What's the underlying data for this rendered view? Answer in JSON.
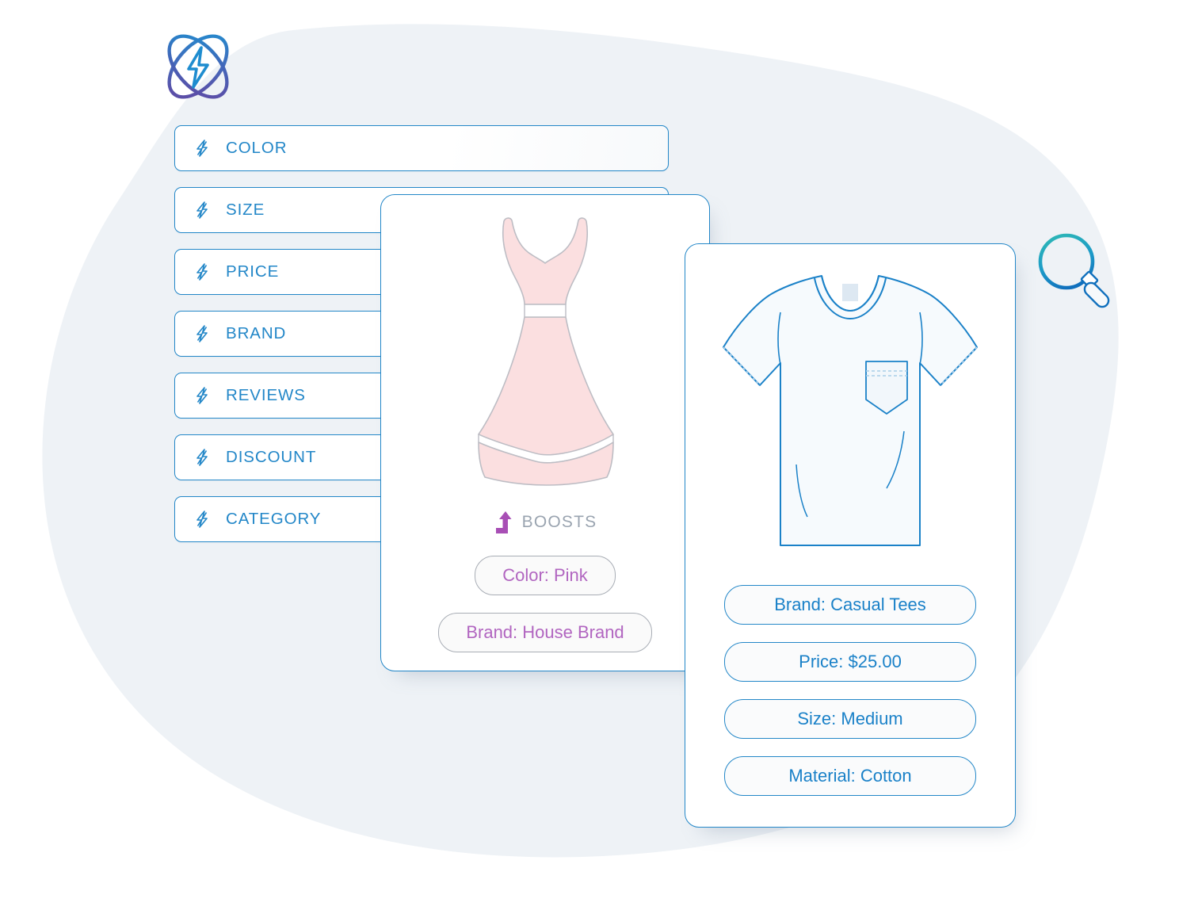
{
  "brand": {
    "logo_icon": "atom-lightning-logo",
    "logo_gradient_from": "#1f8fd0",
    "logo_gradient_to": "#5b4fa8"
  },
  "background": {
    "blob_color": "#eef2f6"
  },
  "facets": {
    "bolt_icon": "lightning-bolt-icon",
    "accent": "#2387c8",
    "items": [
      {
        "label": "COLOR"
      },
      {
        "label": "SIZE"
      },
      {
        "label": "PRICE"
      },
      {
        "label": "BRAND"
      },
      {
        "label": "REVIEWS"
      },
      {
        "label": "DISCOUNT"
      },
      {
        "label": "CATEGORY"
      }
    ]
  },
  "dress_card": {
    "product_icon": "pink-dress-illustration",
    "dress_fill": "#fbdfe0",
    "boosts": {
      "arrow_icon": "boost-up-arrow-icon",
      "arrow_color": "#a84fb5",
      "label": "BOOSTS"
    },
    "pill_text_color": "#b165c0",
    "attributes": [
      {
        "label": "Color: Pink"
      },
      {
        "label": "Brand: House Brand"
      }
    ]
  },
  "shirt_card": {
    "product_icon": "blue-tshirt-illustration",
    "outline_color": "#1a81c8",
    "pill_text_color": "#1a81c8",
    "attributes": [
      {
        "label": "Brand: Casual Tees"
      },
      {
        "label": "Price: $25.00"
      },
      {
        "label": "Size: Medium"
      },
      {
        "label": "Material: Cotton"
      }
    ]
  },
  "search": {
    "icon": "magnifying-glass-icon",
    "gradient_from": "#2cb6b6",
    "gradient_to": "#1070bd"
  }
}
